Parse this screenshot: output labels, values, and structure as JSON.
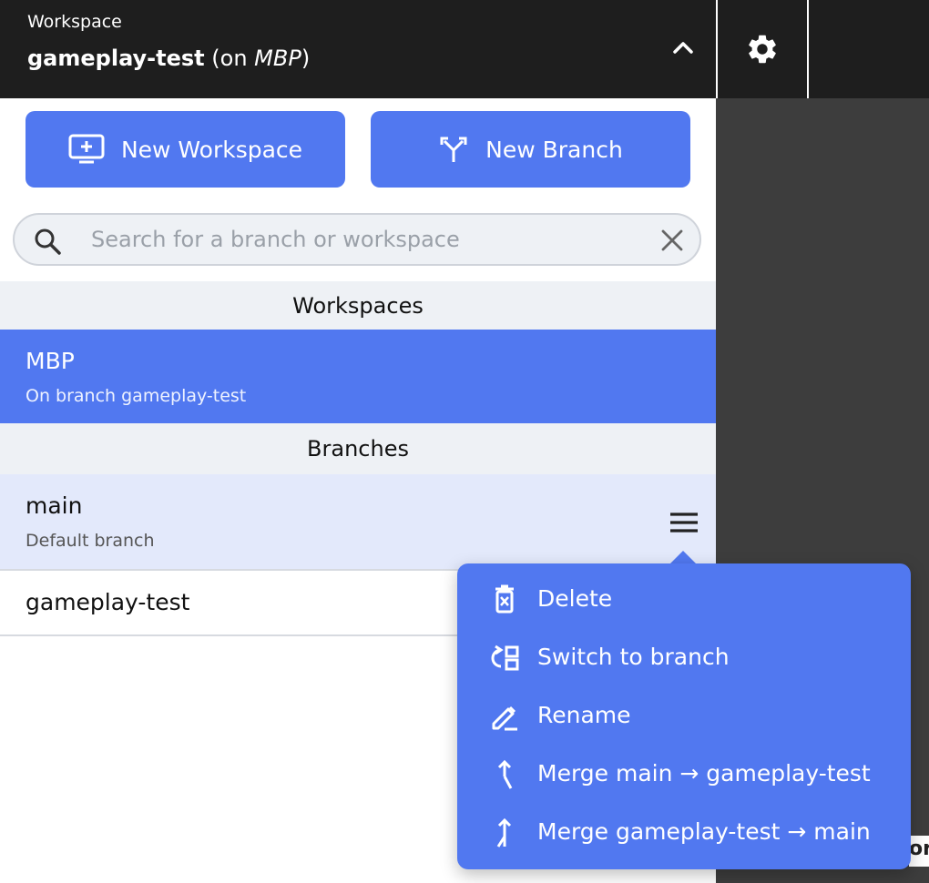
{
  "header": {
    "label": "Workspace",
    "branch": "gameplay-test",
    "on_prefix": " (on ",
    "machine": "MBP",
    "on_suffix": ")"
  },
  "actions": {
    "new_workspace": "New Workspace",
    "new_branch": "New Branch"
  },
  "search": {
    "placeholder": "Search for a branch or workspace",
    "value": ""
  },
  "sections": {
    "workspaces": "Workspaces",
    "branches": "Branches"
  },
  "workspaces": [
    {
      "name": "MBP",
      "subtitle": "On branch gameplay-test"
    }
  ],
  "branches": [
    {
      "name": "main",
      "subtitle": "Default branch"
    },
    {
      "name": "gameplay-test"
    }
  ],
  "context_menu": {
    "items": [
      {
        "label": "Delete",
        "icon": "trash-icon"
      },
      {
        "label": "Switch to branch",
        "icon": "switch-branch-icon"
      },
      {
        "label": "Rename",
        "icon": "pencil-icon"
      },
      {
        "label": "Merge main → gameplay-test",
        "icon": "merge-in-icon"
      },
      {
        "label": "Merge gameplay-test → main",
        "icon": "merge-out-icon"
      }
    ]
  },
  "colors": {
    "accent": "#5178f0",
    "topbar": "#1e1e1e",
    "selected_row": "#e3e9fb",
    "section_bg": "#eef1f5"
  }
}
